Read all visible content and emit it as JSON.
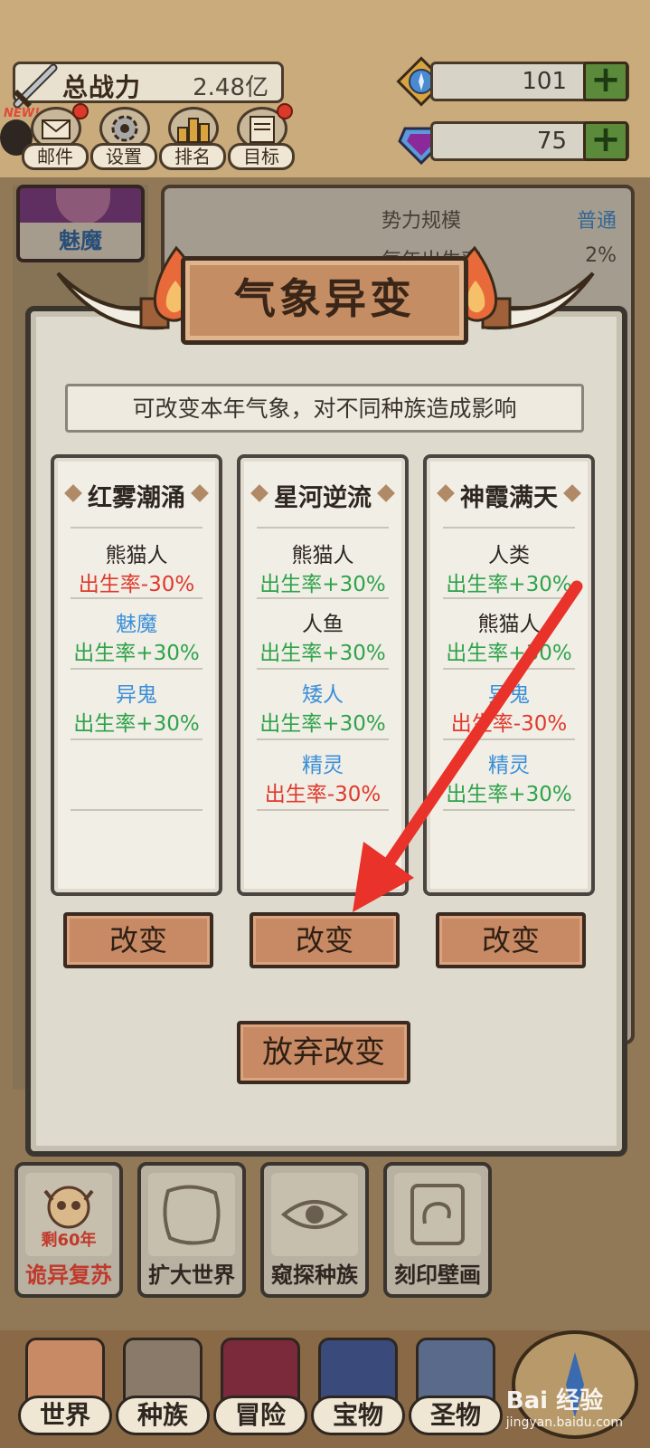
{
  "hud": {
    "power_label": "总战力",
    "power_value": "2.48亿",
    "new_badge": "NEW!",
    "resource_a": "101",
    "resource_b": "75",
    "plus": "+",
    "buttons": [
      {
        "label": "邮件",
        "icon": "mail-icon",
        "notify": true
      },
      {
        "label": "设置",
        "icon": "gear-icon",
        "notify": false
      },
      {
        "label": "排名",
        "icon": "ranking-icon",
        "notify": false
      },
      {
        "label": "目标",
        "icon": "target-scroll-icon",
        "notify": true
      }
    ]
  },
  "background_panel": {
    "race_card": "魅魔",
    "rows": [
      {
        "key": "势力规模",
        "value": "普通"
      },
      {
        "key": "每年出生率",
        "value": "2%"
      }
    ]
  },
  "dialog": {
    "title": "气象异变",
    "subtitle": "可改变本年气象，对不同种族造成影响",
    "change_label": "改变",
    "abandon_label": "放弃改变",
    "cards": [
      {
        "title": "红雾潮涌",
        "effects": [
          {
            "race": "熊猫人",
            "race_color": "#2e2620",
            "effect": "出生率-30%",
            "effect_color": "#e0392b"
          },
          {
            "race": "魅魔",
            "race_color": "#3a8fd8",
            "effect": "出生率+30%",
            "effect_color": "#2fa34a"
          },
          {
            "race": "异鬼",
            "race_color": "#3a8fd8",
            "effect": "出生率+30%",
            "effect_color": "#2fa34a"
          }
        ]
      },
      {
        "title": "星河逆流",
        "effects": [
          {
            "race": "熊猫人",
            "race_color": "#2e2620",
            "effect": "出生率+30%",
            "effect_color": "#2fa34a"
          },
          {
            "race": "人鱼",
            "race_color": "#2e2620",
            "effect": "出生率+30%",
            "effect_color": "#2fa34a"
          },
          {
            "race": "矮人",
            "race_color": "#3a8fd8",
            "effect": "出生率+30%",
            "effect_color": "#2fa34a"
          },
          {
            "race": "精灵",
            "race_color": "#3a8fd8",
            "effect": "出生率-30%",
            "effect_color": "#e0392b"
          }
        ]
      },
      {
        "title": "神霞满天",
        "effects": [
          {
            "race": "人类",
            "race_color": "#2e2620",
            "effect": "出生率+30%",
            "effect_color": "#2fa34a"
          },
          {
            "race": "熊猫人",
            "race_color": "#2e2620",
            "effect": "出生率+30%",
            "effect_color": "#2fa34a"
          },
          {
            "race": "异鬼",
            "race_color": "#3a8fd8",
            "effect": "出生率-30%",
            "effect_color": "#e0392b"
          },
          {
            "race": "精灵",
            "race_color": "#3a8fd8",
            "effect": "出生率+30%",
            "effect_color": "#2fa34a"
          }
        ]
      }
    ]
  },
  "actions": [
    {
      "label": "诡异复苏",
      "badge": "剩60年",
      "label_color": "#c0392b",
      "icon": "skull-icon"
    },
    {
      "label": "扩大世界",
      "badge": "",
      "label_color": "#2e2620",
      "icon": "map-icon"
    },
    {
      "label": "窥探种族",
      "badge": "",
      "label_color": "#2e2620",
      "icon": "eye-icon"
    },
    {
      "label": "刻印壁画",
      "badge": "",
      "label_color": "#2e2620",
      "icon": "mural-icon"
    }
  ],
  "nav": [
    {
      "label": "世界",
      "icon": "world-icon"
    },
    {
      "label": "种族",
      "icon": "race-icon"
    },
    {
      "label": "冒险",
      "icon": "adventure-icon"
    },
    {
      "label": "宝物",
      "icon": "treasure-icon"
    },
    {
      "label": "圣物",
      "icon": "relic-icon"
    }
  ],
  "watermark": {
    "brand": "Bai 经验",
    "url": "jingyan.baidu.com"
  },
  "colors": {
    "positive": "#2fa34a",
    "negative": "#e0392b",
    "race_blue": "#3a8fd8",
    "arrow": "#e8322a"
  }
}
